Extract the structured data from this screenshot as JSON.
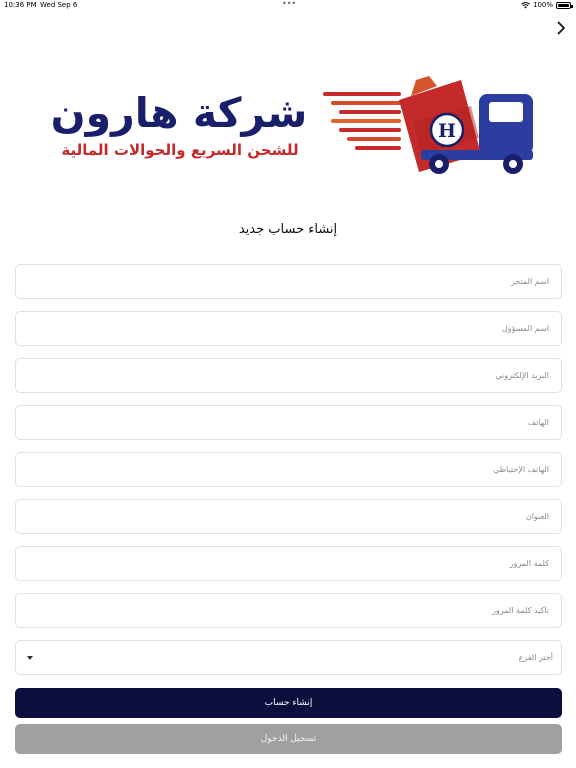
{
  "status_bar": {
    "time": "10:36 PM",
    "date": "Wed Sep 6",
    "multitask_dots": "•••",
    "battery": "100%",
    "battery_level": 1.0
  },
  "navigation": {
    "forward_icon": "chevron-right-icon"
  },
  "logo": {
    "name": "شركة هارون",
    "tagline": "للشحن السريع والحوالات المالية",
    "truck_letter": "H",
    "colors": {
      "navy": "#1a1f6b",
      "red": "#c42a2a",
      "blue": "#2b3ea0"
    }
  },
  "form": {
    "title": "إنشاء حساب جديد",
    "fields": {
      "store_name": {
        "placeholder": "اسم المتجر",
        "value": ""
      },
      "manager_name": {
        "placeholder": "اسم المسؤول",
        "value": ""
      },
      "email": {
        "placeholder": "البريد الإلكتروني",
        "value": ""
      },
      "phone": {
        "placeholder": "الهاتف",
        "value": ""
      },
      "backup_phone": {
        "placeholder": "الهاتف الإحتياطي",
        "value": ""
      },
      "address": {
        "placeholder": "العنوان",
        "value": ""
      },
      "password": {
        "placeholder": "كلمة المرور",
        "value": ""
      },
      "confirm_password": {
        "placeholder": "تأكيد كلمة المرور",
        "value": ""
      }
    },
    "branch_select": {
      "placeholder": "أختر الفرع"
    },
    "create_account_label": "إنشاء حساب",
    "login_label": "تسجيل الدخول"
  },
  "colors": {
    "primary_button": "#0c0e3e",
    "secondary_button": "#a0a0a0",
    "field_border": "#e0e0e0"
  }
}
